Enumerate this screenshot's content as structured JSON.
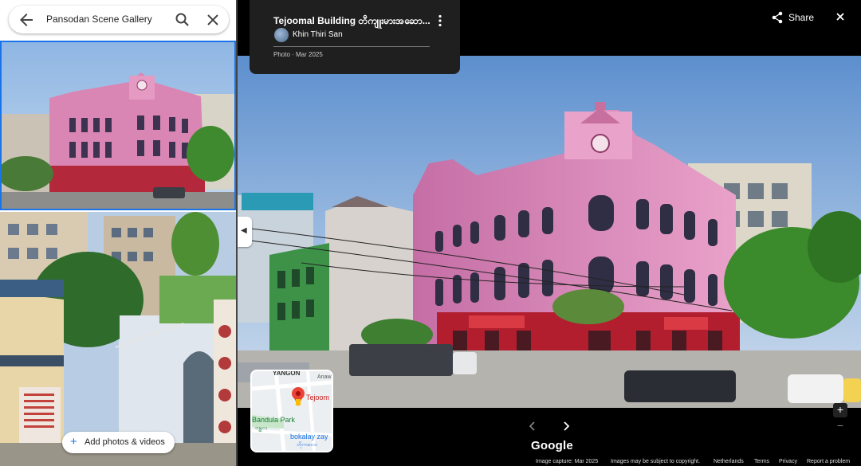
{
  "search": {
    "query": "Pansodan Scene Gallery"
  },
  "left_panel": {
    "add_photos_label": "Add photos & videos",
    "add_icon": "plus-icon"
  },
  "viewer": {
    "title": "Tejoomal Building တီကျူးမားအဆော...",
    "author": "Khin Thiri San",
    "meta": "Photo · Mar 2025",
    "share_label": "Share",
    "minimap": {
      "city": "YANGON",
      "street": "Anaw",
      "place": "Tejoom",
      "park": "Bandula Park",
      "park_local": "ဗန္ဓုလ",
      "local": "bokalay zay",
      "local2": "ဘိုကလေး"
    },
    "logo": "Google",
    "footer": {
      "capture": "Image capture: Mar 2025",
      "copyright": "Images may be subject to copyright.",
      "region": "Netherlands",
      "terms": "Terms",
      "privacy": "Privacy",
      "report": "Report a problem"
    }
  },
  "colors": {
    "accent": "#1a73e8",
    "pin": "#ea4335"
  }
}
